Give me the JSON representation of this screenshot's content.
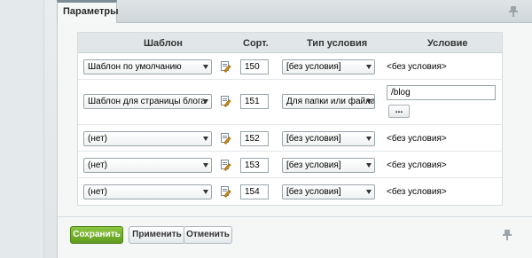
{
  "tab": {
    "label": "Параметры"
  },
  "table": {
    "headers": {
      "template": "Шаблон",
      "sort": "Сорт.",
      "condition_type": "Тип условия",
      "condition": "Условие"
    },
    "rows": [
      {
        "template": "Шаблон по умолчанию",
        "sort": "150",
        "condition_type": "[без условия]",
        "condition": "<без условия>"
      },
      {
        "template": "Шаблон для страницы блога",
        "sort": "151",
        "condition_type": "Для папки или файла",
        "condition_value": "/blog",
        "browse_label": "..."
      },
      {
        "template": "(нет)",
        "sort": "152",
        "condition_type": "[без условия]",
        "condition": "<без условия>"
      },
      {
        "template": "(нет)",
        "sort": "153",
        "condition_type": "[без условия]",
        "condition": "<без условия>"
      },
      {
        "template": "(нет)",
        "sort": "154",
        "condition_type": "[без условия]",
        "condition": "<без условия>"
      }
    ]
  },
  "buttons": {
    "save": "Сохранить",
    "apply": "Применить",
    "cancel": "Отменить"
  },
  "colors": {
    "primary_button": "#6aa82a",
    "tab_border": "#7d8e96"
  }
}
